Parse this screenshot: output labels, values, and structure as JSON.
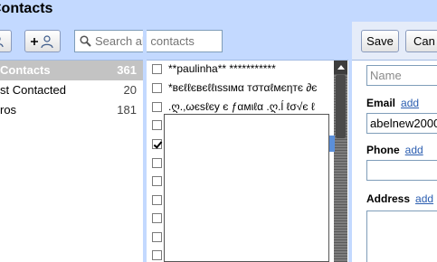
{
  "window": {
    "title": "Contacts"
  },
  "toolbar": {
    "search_placeholder": "Search all contacts",
    "save_label": "Save",
    "cancel_label": "Can"
  },
  "groups": [
    {
      "label": "Contacts",
      "count": "361",
      "selected": true
    },
    {
      "label": "st Contacted",
      "count": "20",
      "selected": false
    },
    {
      "label": "ros",
      "count": "181",
      "selected": false
    }
  ],
  "contacts": [
    {
      "name": "**paulinha** ***********",
      "checked": false
    },
    {
      "name": "*вєℓℓєвєℓℓιѕѕιмα тσтαℓмєηтє ∂є",
      "checked": false
    },
    {
      "name": ".ღ.,ωєѕℓєу є ƒαмιℓα .ღ.ĺ ℓσ√є ℓ",
      "checked": false
    },
    {
      "name": "",
      "checked": true
    },
    {
      "name": "",
      "checked": false
    },
    {
      "name": "",
      "checked": false
    },
    {
      "name": "",
      "checked": false
    },
    {
      "name": "",
      "checked": false
    },
    {
      "name": "",
      "checked": false
    },
    {
      "name": "",
      "checked": false
    },
    {
      "name": "",
      "checked": false
    }
  ],
  "detail": {
    "name_placeholder": "Name",
    "email_label": "Email",
    "email_add": "add",
    "email_value": "abelnew2000",
    "phone_label": "Phone",
    "phone_add": "add",
    "address_label": "Address",
    "address_add": "add"
  },
  "colors": {
    "header_blue": "#c3d9ff",
    "selected_group": "#c3c3c3",
    "link": "#2a5db0"
  }
}
